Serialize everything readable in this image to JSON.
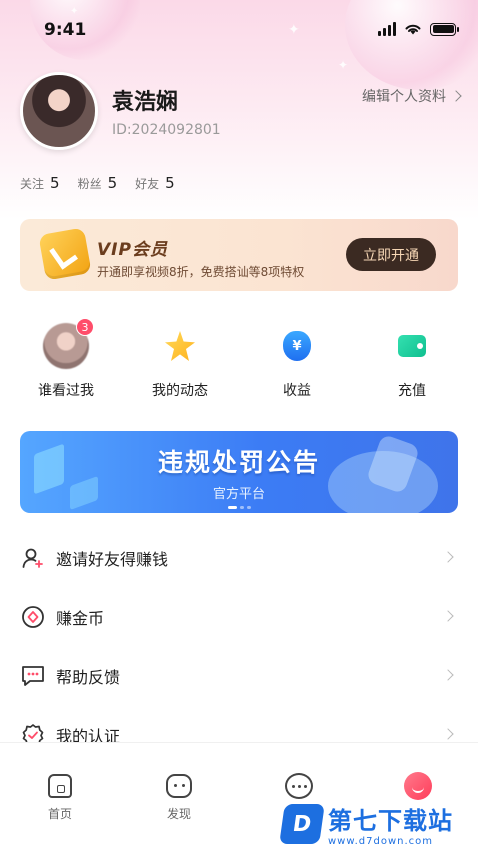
{
  "status_bar": {
    "time": "9:41"
  },
  "profile": {
    "name": "袁浩娴",
    "id": "ID:2024092801",
    "edit_label": "编辑个人资料"
  },
  "stats": [
    {
      "label": "关注",
      "value": "5"
    },
    {
      "label": "粉丝",
      "value": "5"
    },
    {
      "label": "好友",
      "value": "5"
    }
  ],
  "vip": {
    "title": "VIP会员",
    "description": "开通即享视频8折，免费搭讪等8项特权",
    "button": "立即开通"
  },
  "quick_actions": [
    {
      "label": "谁看过我",
      "icon": "visitor-avatar-icon",
      "badge": "3"
    },
    {
      "label": "我的动态",
      "icon": "star-face-icon"
    },
    {
      "label": "收益",
      "icon": "money-bag-icon",
      "glyph": "¥"
    },
    {
      "label": "充值",
      "icon": "wallet-icon"
    }
  ],
  "banner": {
    "title": "违规处罚公告",
    "subtitle": "官方平台"
  },
  "menu": [
    {
      "label": "邀请好友得赚钱",
      "icon": "invite-user-icon"
    },
    {
      "label": "赚金币",
      "icon": "coin-icon"
    },
    {
      "label": "帮助反馈",
      "icon": "feedback-icon"
    },
    {
      "label": "我的认证",
      "icon": "verified-badge-icon"
    }
  ],
  "bottom_nav": [
    {
      "label": "首页",
      "icon": "home-icon"
    },
    {
      "label": "发现",
      "icon": "discover-icon"
    },
    {
      "label": "",
      "icon": "chat-icon"
    },
    {
      "label": "",
      "icon": "me-icon"
    }
  ],
  "watermark": {
    "logo": "D",
    "title": "第七下载站",
    "url": "www.d7down.com"
  },
  "colors": {
    "accent": "#ff4d6a",
    "vip_button_bg": "#3b2a22",
    "banner_blue": "#3c7cf5"
  }
}
